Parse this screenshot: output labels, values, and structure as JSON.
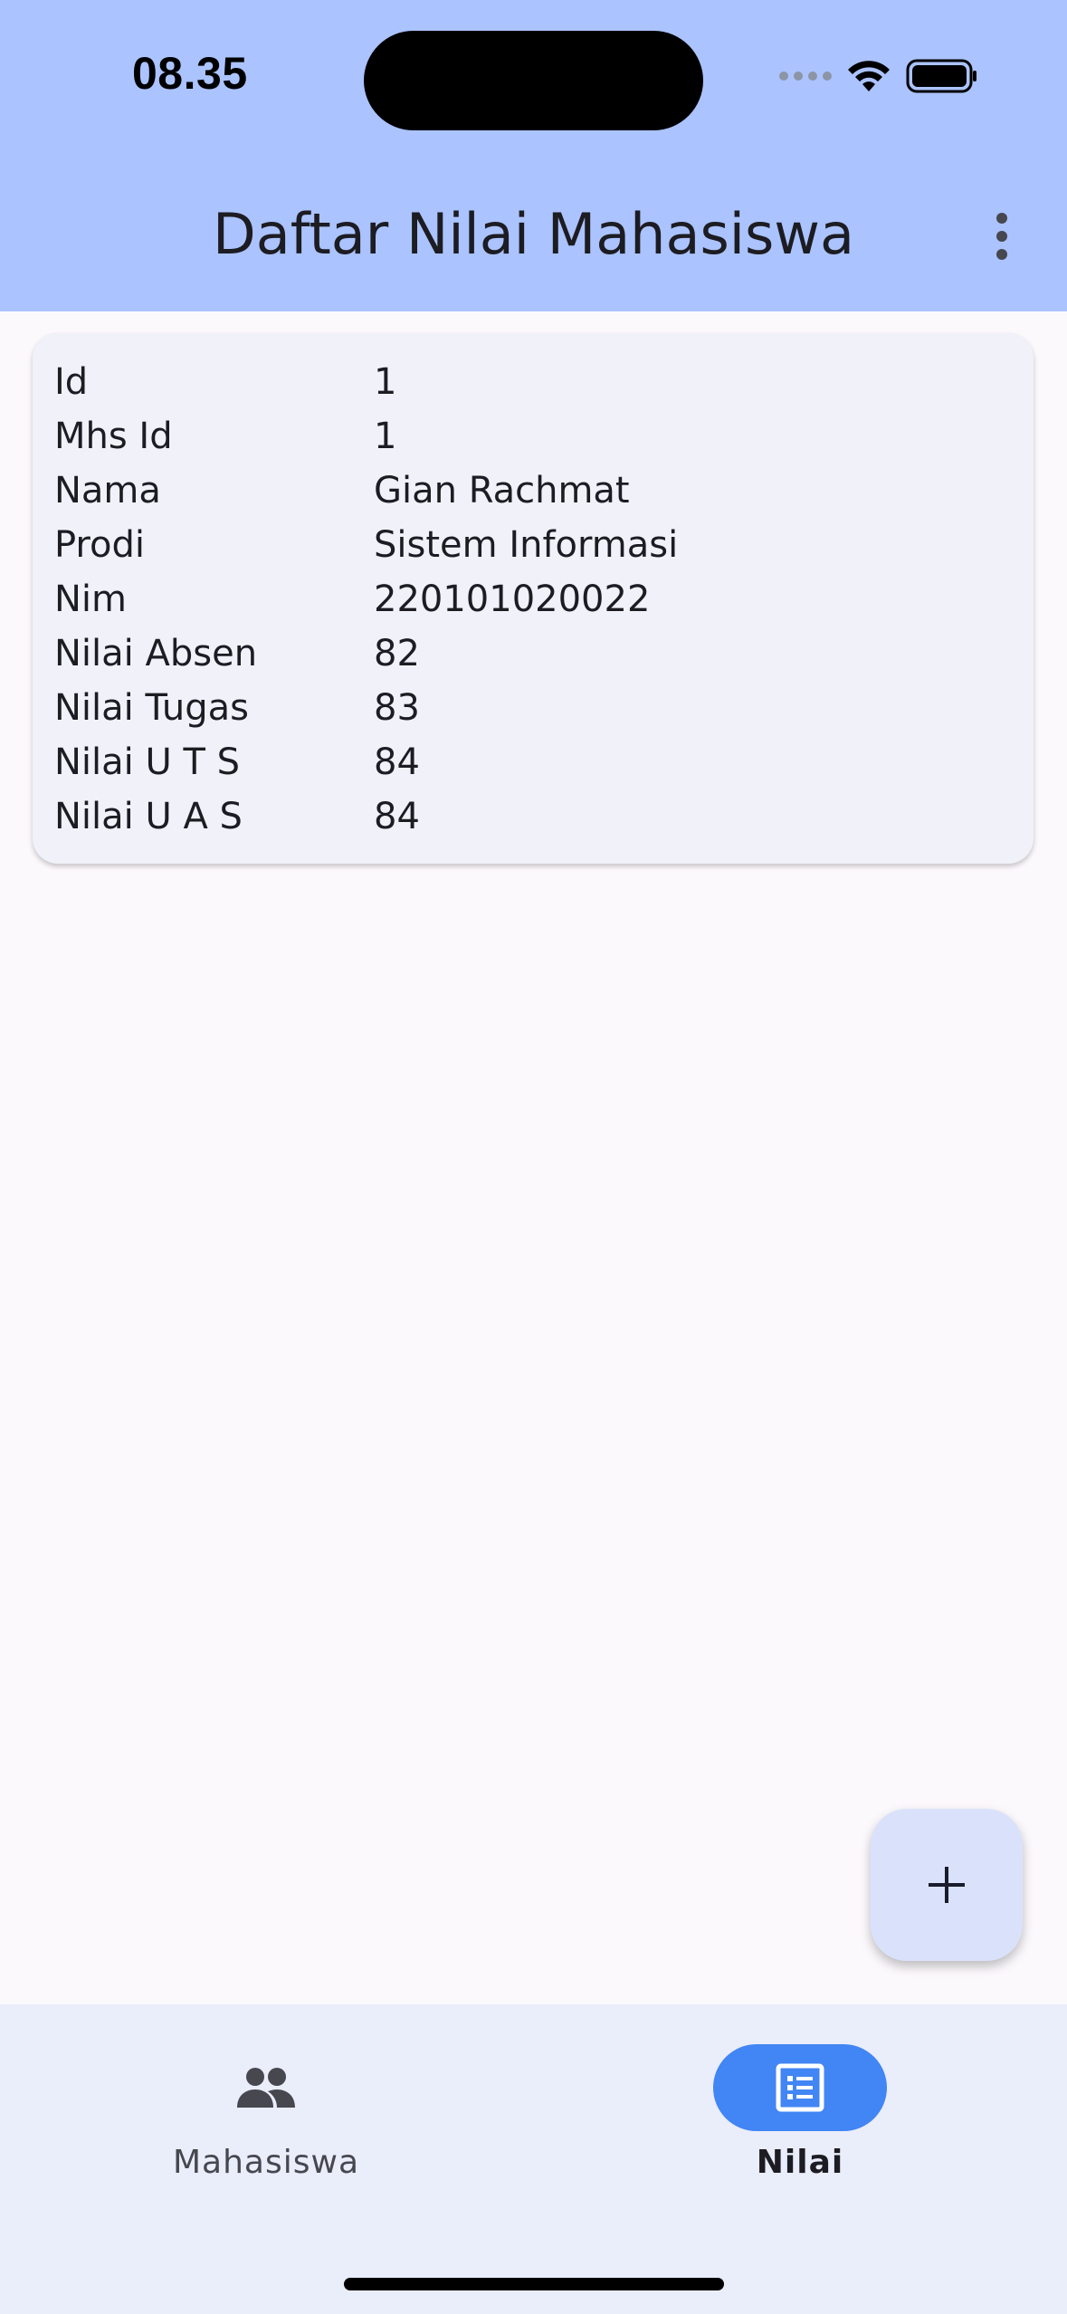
{
  "status_bar": {
    "time": "08.35"
  },
  "app_bar": {
    "title": "Daftar Nilai Mahasiswa",
    "menu_icon": "more-vert-icon"
  },
  "record": {
    "rows": [
      {
        "label": "Id",
        "value": "1"
      },
      {
        "label": "Mhs Id",
        "value": "1"
      },
      {
        "label": "Nama",
        "value": "Gian Rachmat"
      },
      {
        "label": "Prodi",
        "value": "Sistem Informasi"
      },
      {
        "label": "Nim",
        "value": "220101020022"
      },
      {
        "label": "Nilai Absen",
        "value": "82"
      },
      {
        "label": "Nilai Tugas",
        "value": "83"
      },
      {
        "label": "Nilai U T S",
        "value": "84"
      },
      {
        "label": "Nilai U A S",
        "value": "84"
      }
    ]
  },
  "fab": {
    "icon": "add-icon"
  },
  "bottom_nav": {
    "items": [
      {
        "label": "Mahasiswa",
        "icon": "people-icon",
        "active": false
      },
      {
        "label": "Nilai",
        "icon": "list-alt-icon",
        "active": true
      }
    ]
  },
  "colors": {
    "app_bar": "#abc3fe",
    "card": "#f1f1f9",
    "fab": "#dae2fb",
    "nav_bar": "#eaedfa",
    "nav_active_pill": "#4285f4"
  }
}
